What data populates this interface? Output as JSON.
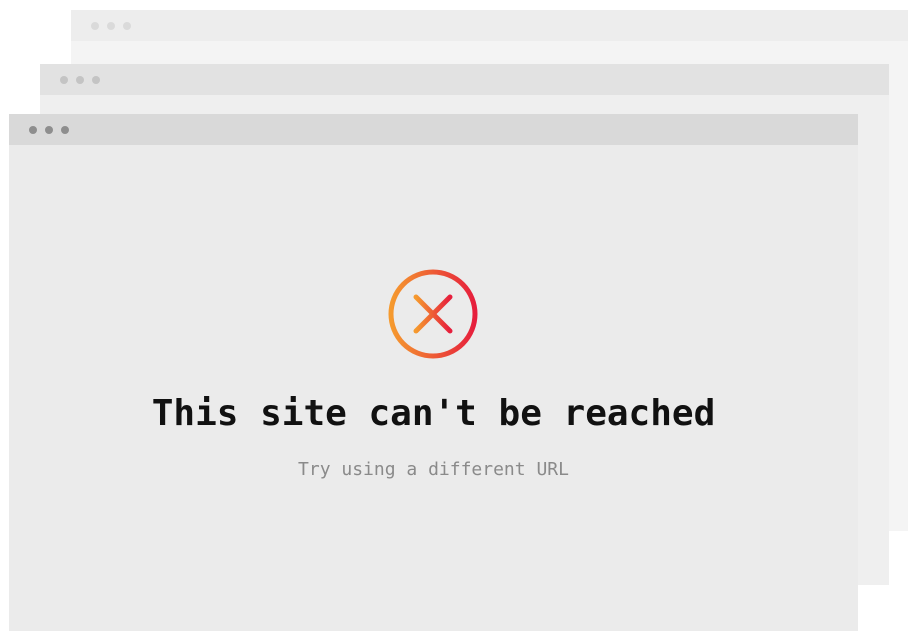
{
  "error": {
    "title": "This site can't be reached",
    "subtitle": "Try using a different URL",
    "icon": "error-x-circle-icon",
    "icon_gradient": [
      "#f59a2e",
      "#e61e3c"
    ]
  },
  "colors": {
    "headline": "#111111",
    "subtext": "#8a8a8a"
  }
}
